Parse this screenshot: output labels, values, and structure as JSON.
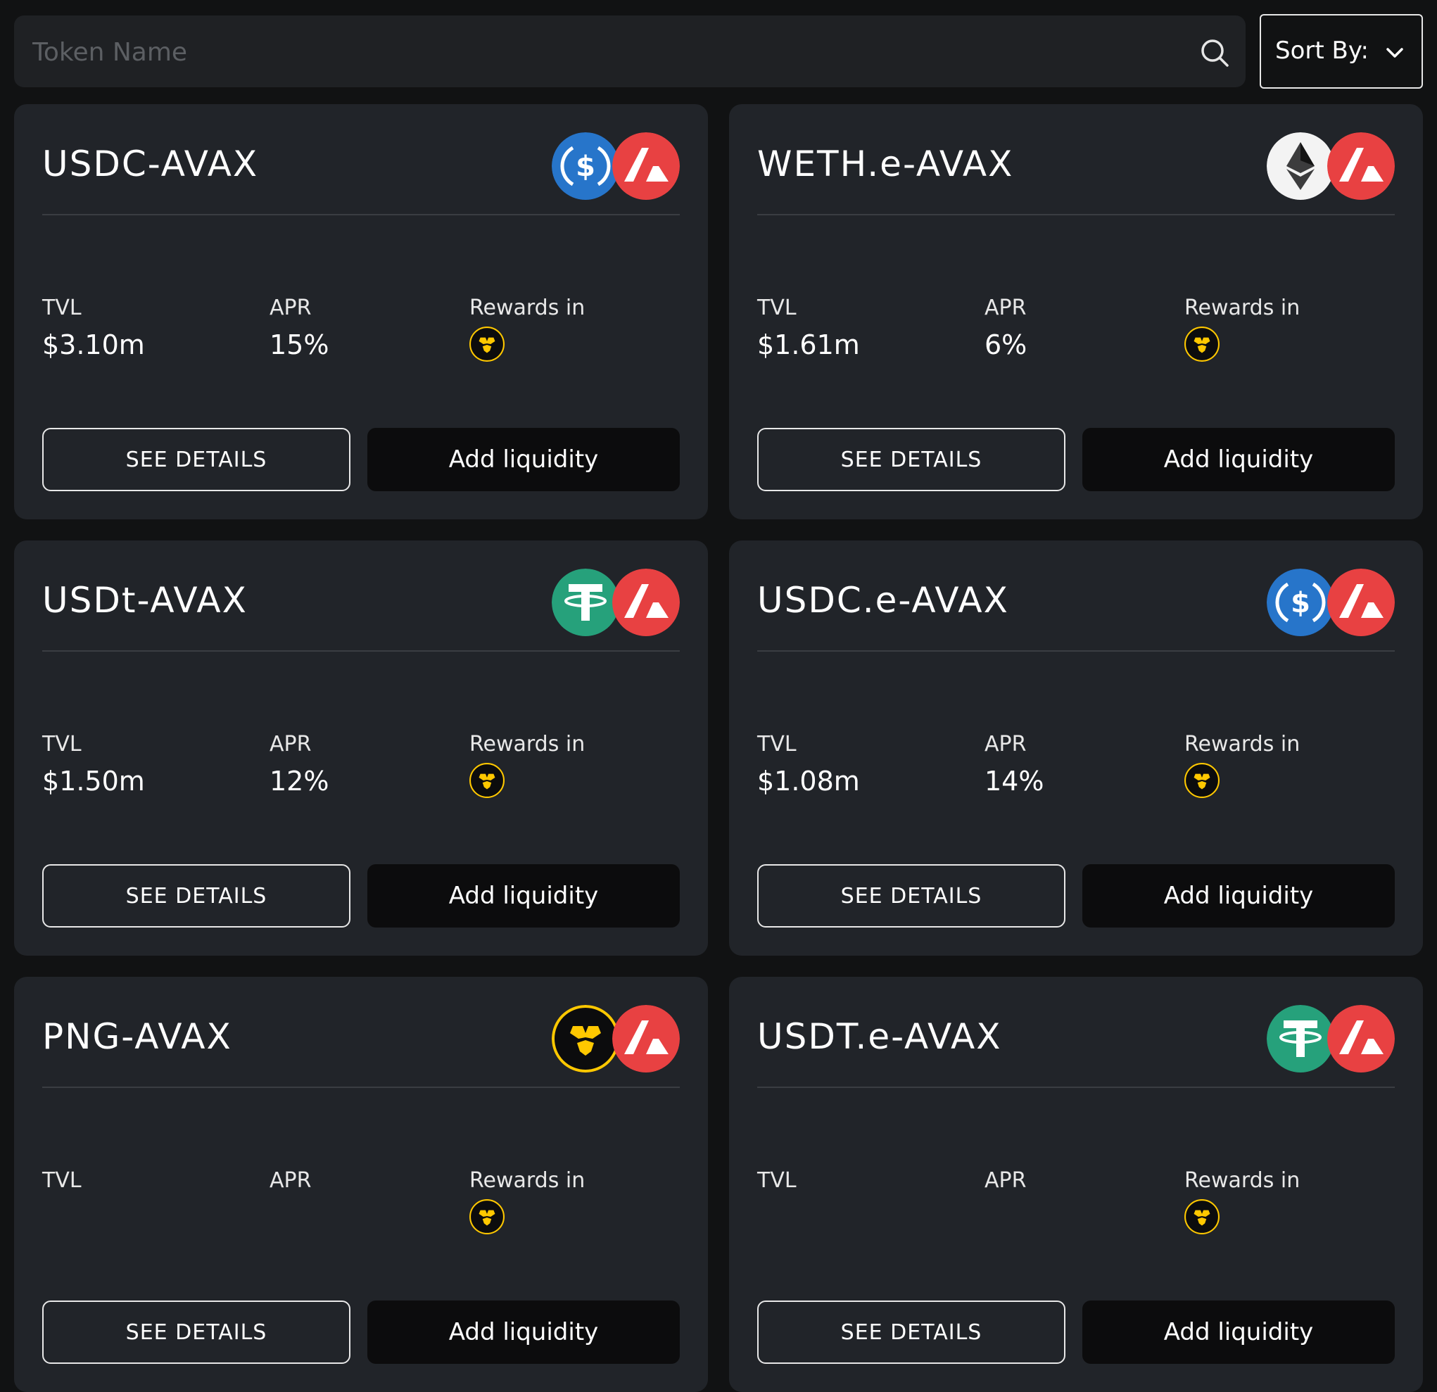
{
  "search": {
    "placeholder": "Token Name",
    "icon": "search-icon"
  },
  "sort": {
    "label": "Sort By:",
    "icon": "chevron-down-icon"
  },
  "labels": {
    "tvl": "TVL",
    "apr": "APR",
    "rewards": "Rewards in"
  },
  "buttons": {
    "details": "SEE DETAILS",
    "add": "Add liquidity"
  },
  "colors": {
    "avax": "#e84142",
    "usdc": "#2775ca",
    "usdt": "#26a17b",
    "png": "#ffc800",
    "card": "#212429",
    "bg": "#111213"
  },
  "pools": [
    {
      "name": "USDC-AVAX",
      "token_a": "usdc-icon",
      "token_b": "avax-icon",
      "tvl": "$3.10m",
      "apr": "15%",
      "reward_token": "png-icon"
    },
    {
      "name": "WETH.e-AVAX",
      "token_a": "eth-icon",
      "token_b": "avax-icon",
      "tvl": "$1.61m",
      "apr": "6%",
      "reward_token": "png-icon"
    },
    {
      "name": "USDt-AVAX",
      "token_a": "usdt-icon",
      "token_b": "avax-icon",
      "tvl": "$1.50m",
      "apr": "12%",
      "reward_token": "png-icon"
    },
    {
      "name": "USDC.e-AVAX",
      "token_a": "usdc-icon",
      "token_b": "avax-icon",
      "tvl": "$1.08m",
      "apr": "14%",
      "reward_token": "png-icon"
    },
    {
      "name": "PNG-AVAX",
      "token_a": "png-icon",
      "token_b": "avax-icon",
      "tvl": "",
      "apr": "",
      "reward_token": "png-icon"
    },
    {
      "name": "USDT.e-AVAX",
      "token_a": "usdt-icon",
      "token_b": "avax-icon",
      "tvl": "",
      "apr": "",
      "reward_token": "png-icon"
    }
  ]
}
